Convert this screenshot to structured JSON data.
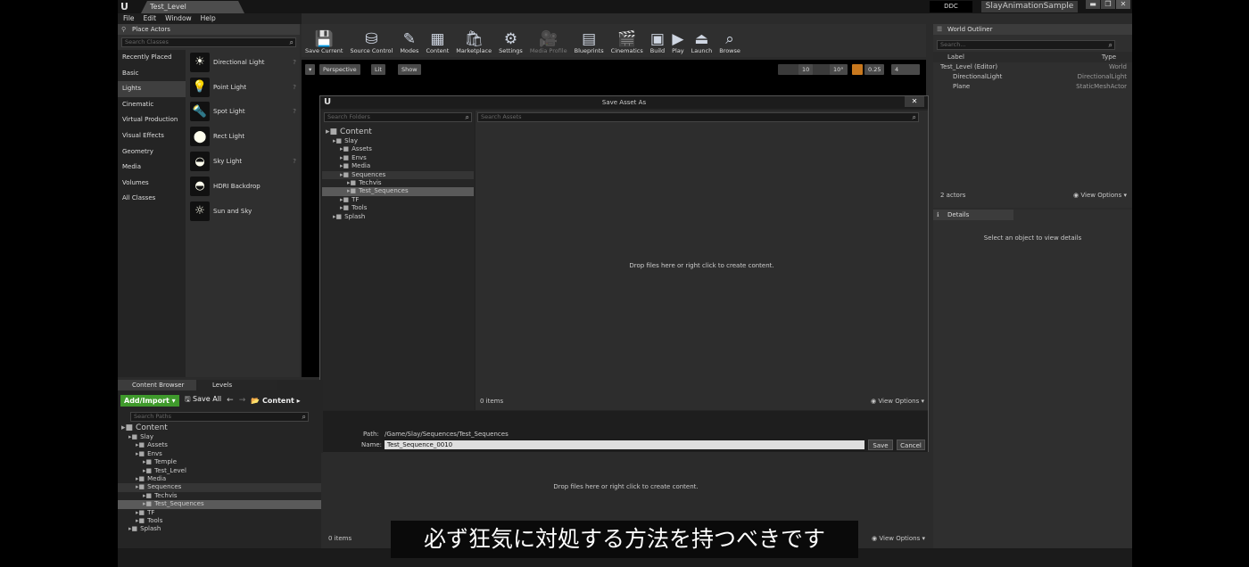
{
  "titlebar": {
    "doc_tab": "Test_Level",
    "ddc": "DDC",
    "project": "SlayAnimationSample",
    "min": "▬",
    "max": "❐",
    "close": "✕"
  },
  "menu": [
    "File",
    "Edit",
    "Window",
    "Help"
  ],
  "place_actors": {
    "title": "Place Actors",
    "search_placeholder": "Search Classes",
    "categories": [
      "Recently Placed",
      "Basic",
      "Lights",
      "Cinematic",
      "Virtual Production",
      "Visual Effects",
      "Geometry",
      "Media",
      "Volumes",
      "All Classes"
    ],
    "selected_category": "Lights",
    "items": [
      {
        "label": "Directional Light",
        "icon": "directional-light-icon",
        "glyph": "☀"
      },
      {
        "label": "Point Light",
        "icon": "point-light-icon",
        "glyph": "💡"
      },
      {
        "label": "Spot Light",
        "icon": "spot-light-icon",
        "glyph": "🔦"
      },
      {
        "label": "Rect Light",
        "icon": "rect-light-icon",
        "glyph": "⬤"
      },
      {
        "label": "Sky Light",
        "icon": "sky-light-icon",
        "glyph": "◒"
      },
      {
        "label": "HDRI Backdrop",
        "icon": "hdri-backdrop-icon",
        "glyph": "◓"
      },
      {
        "label": "Sun and Sky",
        "icon": "sun-and-sky-icon",
        "glyph": "☼"
      }
    ]
  },
  "toolbar": [
    {
      "label": "Save Current",
      "icon": "save-icon",
      "glyph": "💾"
    },
    {
      "label": "Source Control",
      "icon": "source-control-icon",
      "glyph": "⛁"
    },
    {
      "label": "Modes",
      "icon": "modes-icon",
      "glyph": "✎"
    },
    {
      "label": "Content",
      "icon": "content-icon",
      "glyph": "▦"
    },
    {
      "label": "Marketplace",
      "icon": "marketplace-icon",
      "glyph": "🛍"
    },
    {
      "label": "Settings",
      "icon": "settings-icon",
      "glyph": "⚙"
    },
    {
      "label": "Media Profile",
      "icon": "media-profile-icon",
      "glyph": "🎥",
      "dim": true
    },
    {
      "label": "Blueprints",
      "icon": "blueprints-icon",
      "glyph": "▤"
    },
    {
      "label": "Cinematics",
      "icon": "cinematics-icon",
      "glyph": "🎬"
    },
    {
      "label": "Build",
      "icon": "build-icon",
      "glyph": "▣"
    },
    {
      "label": "Play",
      "icon": "play-icon",
      "glyph": "▶"
    },
    {
      "label": "Launch",
      "icon": "launch-icon",
      "glyph": "⏏"
    },
    {
      "label": "Browse",
      "icon": "browse-icon",
      "glyph": "⌕"
    }
  ],
  "viewport": {
    "perspective": "Perspective",
    "lit": "Lit",
    "show": "Show",
    "grid": "10",
    "angle": "10°",
    "scale": "0.25",
    "cam": "4"
  },
  "dialog": {
    "title": "Save Asset As",
    "search_folders": "Search Folders",
    "search_assets": "Search Assets",
    "tree": [
      {
        "label": "Content",
        "lvl": 0,
        "big": true
      },
      {
        "label": "Slay",
        "lvl": 1
      },
      {
        "label": "Assets",
        "lvl": 2
      },
      {
        "label": "Envs",
        "lvl": 2
      },
      {
        "label": "Media",
        "lvl": 2
      },
      {
        "label": "Sequences",
        "lvl": 2,
        "row": true
      },
      {
        "label": "Techvis",
        "lvl": 3
      },
      {
        "label": "Test_Sequences",
        "lvl": 3,
        "sel": true
      },
      {
        "label": "TF",
        "lvl": 2
      },
      {
        "label": "Tools",
        "lvl": 2
      },
      {
        "label": "Splash",
        "lvl": 1
      }
    ],
    "empty_msg": "Drop files here or right click to create content.",
    "count": "0 items",
    "view_options": "View Options",
    "path_label": "Path:",
    "path": "/Game/Slay/Sequences/Test_Sequences",
    "name_label": "Name:",
    "name": "Test_Sequence_0010",
    "save": "Save",
    "cancel": "Cancel"
  },
  "outliner": {
    "title": "World Outliner",
    "search_placeholder": "Search...",
    "col_label": "Label",
    "col_type": "Type",
    "rows": [
      {
        "label": "Test_Level (Editor)",
        "type": "World"
      },
      {
        "label": "DirectionalLight",
        "type": "DirectionalLight"
      },
      {
        "label": "Plane",
        "type": "StaticMeshActor"
      }
    ],
    "count": "2 actors",
    "view_options": "View Options"
  },
  "details": {
    "title": "Details",
    "empty": "Select an object to view details"
  },
  "content_browser": {
    "tab1": "Content Browser",
    "tab2": "Levels",
    "add_import": "Add/Import",
    "save_all": "Save All",
    "breadcrumb": "Content",
    "search_placeholder": "Search Paths",
    "tree": [
      {
        "label": "Content",
        "lvl": 0,
        "big": true
      },
      {
        "label": "Slay",
        "lvl": 1
      },
      {
        "label": "Assets",
        "lvl": 2
      },
      {
        "label": "Envs",
        "lvl": 2
      },
      {
        "label": "Temple",
        "lvl": 3
      },
      {
        "label": "Test_Level",
        "lvl": 3
      },
      {
        "label": "Media",
        "lvl": 2
      },
      {
        "label": "Sequences",
        "lvl": 2,
        "row": true
      },
      {
        "label": "Techvis",
        "lvl": 3
      },
      {
        "label": "Test_Sequences",
        "lvl": 3,
        "sel": true
      },
      {
        "label": "TF",
        "lvl": 2
      },
      {
        "label": "Tools",
        "lvl": 2
      },
      {
        "label": "Splash",
        "lvl": 1
      }
    ],
    "empty_msg": "Drop files here or right click to create content.",
    "count": "0 items",
    "view_options": "View Options"
  },
  "subtitle": "必ず狂気に対処する方法を持つべきです"
}
